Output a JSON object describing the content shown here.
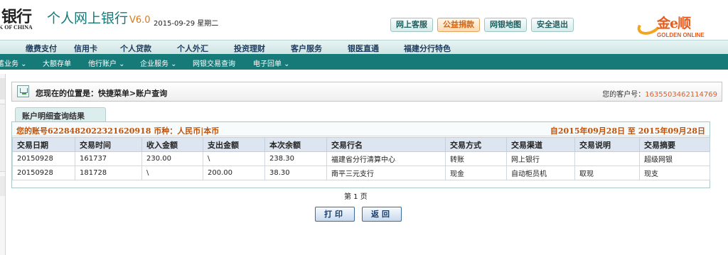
{
  "header": {
    "bank_name": "银行",
    "bank_name_en": "K OF CHINA",
    "site_title": "个人网上银行",
    "version": "V6.0",
    "date": "2015-09-29 星期二",
    "buttons": [
      {
        "label": "网上客服",
        "highlight": false
      },
      {
        "label": "公益捐款",
        "highlight": true
      },
      {
        "label": "网银地图",
        "highlight": false
      },
      {
        "label": "安全退出",
        "highlight": false
      }
    ],
    "partner_logo": {
      "text": "金e顺",
      "subtext": "GOLDEN ONLINE"
    }
  },
  "nav_main": [
    "缴费支付",
    "信用卡",
    "个人贷款",
    "个人外汇",
    "投资理财",
    "客户服务",
    "银医直通",
    "福建分行特色"
  ],
  "nav_sub": [
    "蓄业务 ⌄",
    "大额存单",
    "他行账户 ⌄",
    "企业服务 ⌄",
    "网银交易查询",
    "电子回单 ⌄"
  ],
  "location": {
    "text": "您现在的位置是：快捷菜单>账户查询",
    "customer_label": "您的客户号：",
    "customer_no": "1635503462114769"
  },
  "tab_label": "账户明细查询结果",
  "summary": {
    "account": "您的账号6228482022321620918 币种：人民币|本币",
    "date_range": "自2015年09月28日  至  2015年09月28日"
  },
  "table": {
    "columns": [
      "交易日期",
      "交易时间",
      "收入金额",
      "支出金额",
      "本次余额",
      "交易行名",
      "交易方式",
      "交易渠道",
      "交易说明",
      "交易摘要"
    ],
    "rows": [
      [
        "20150928",
        "161737",
        "230.00",
        "\\",
        "238.30",
        "福建省分行清算中心",
        "转账",
        "网上银行",
        "",
        "超级网银"
      ],
      [
        "20150928",
        "181728",
        "\\",
        "200.00",
        "38.30",
        "南平三元支行",
        "现金",
        "自动柜员机",
        "取现",
        "现支"
      ]
    ]
  },
  "page_indicator": "第 1 页",
  "actions": {
    "print": "打印",
    "back": "返回"
  },
  "colors": {
    "brand_teal": "#167a79",
    "accent_orange": "#ea5a1c"
  }
}
